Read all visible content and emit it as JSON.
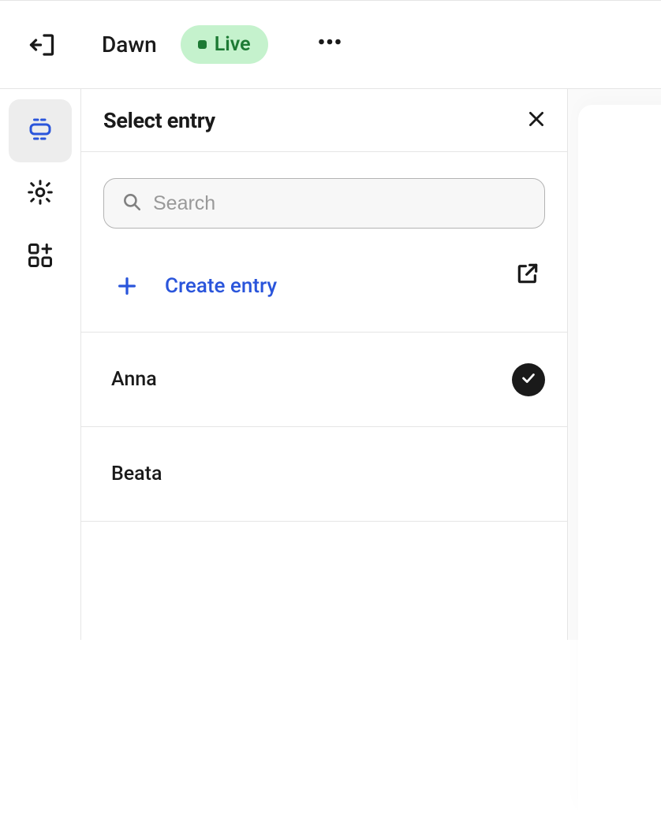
{
  "header": {
    "site_name": "Dawn",
    "status_label": "Live"
  },
  "panel": {
    "title": "Select entry",
    "search_placeholder": "Search",
    "create_label": "Create entry",
    "entries": [
      {
        "name": "Anna",
        "selected": true
      },
      {
        "name": "Beata",
        "selected": false
      }
    ]
  }
}
